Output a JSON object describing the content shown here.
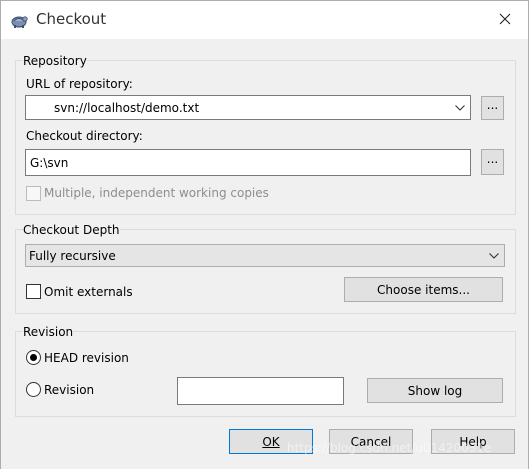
{
  "window": {
    "title": "Checkout"
  },
  "repository": {
    "group_title": "Repository",
    "url_label": "URL of repository:",
    "url_value": "svn://localhost/demo.txt",
    "browse_label": "...",
    "dir_label": "Checkout directory:",
    "dir_value": "G:\\svn",
    "dir_browse_label": "...",
    "multiple_label": "Multiple, independent working copies"
  },
  "depth": {
    "group_title": "Checkout Depth",
    "selected": "Fully recursive",
    "omit_externals_label": "Omit externals",
    "choose_items_label": "Choose items..."
  },
  "revision": {
    "group_title": "Revision",
    "head_label": "HEAD revision",
    "revision_label": "Revision",
    "revision_value": "",
    "show_log_label": "Show log"
  },
  "footer": {
    "ok_label": "OK",
    "cancel_label": "Cancel",
    "help_label": "Help"
  },
  "watermark": "https://blog.csdn.net/u01420031e"
}
